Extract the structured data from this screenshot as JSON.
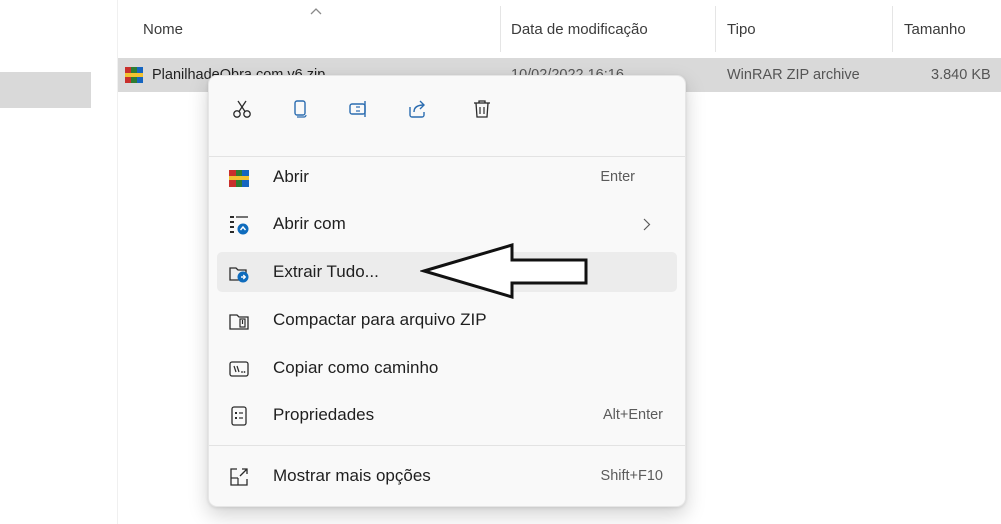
{
  "columns": {
    "name": "Nome",
    "modified": "Data de modificação",
    "type": "Tipo",
    "size": "Tamanho"
  },
  "file": {
    "name": "PlanilhadeObra.com.v6.zip",
    "modified": "10/02/2022 16:16",
    "type": "WinRAR ZIP archive",
    "size": "3.840 KB"
  },
  "quick_actions": [
    {
      "icon": "cut-icon"
    },
    {
      "icon": "copy-icon"
    },
    {
      "icon": "rename-icon"
    },
    {
      "icon": "share-icon"
    },
    {
      "icon": "delete-icon"
    }
  ],
  "menu": {
    "open": {
      "label": "Abrir",
      "accel": "Enter"
    },
    "open_with": {
      "label": "Abrir com"
    },
    "extract_all": {
      "label": "Extrair Tudo..."
    },
    "compress_zip": {
      "label": "Compactar para arquivo ZIP"
    },
    "copy_path": {
      "label": "Copiar como caminho"
    },
    "properties": {
      "label": "Propriedades",
      "accel": "Alt+Enter"
    },
    "more_options": {
      "label": "Mostrar mais opções",
      "accel": "Shift+F10"
    }
  },
  "colors": {
    "accent": "#0067c0",
    "selection": "#d9d9d9",
    "menu_bg": "#f9f9f9"
  }
}
